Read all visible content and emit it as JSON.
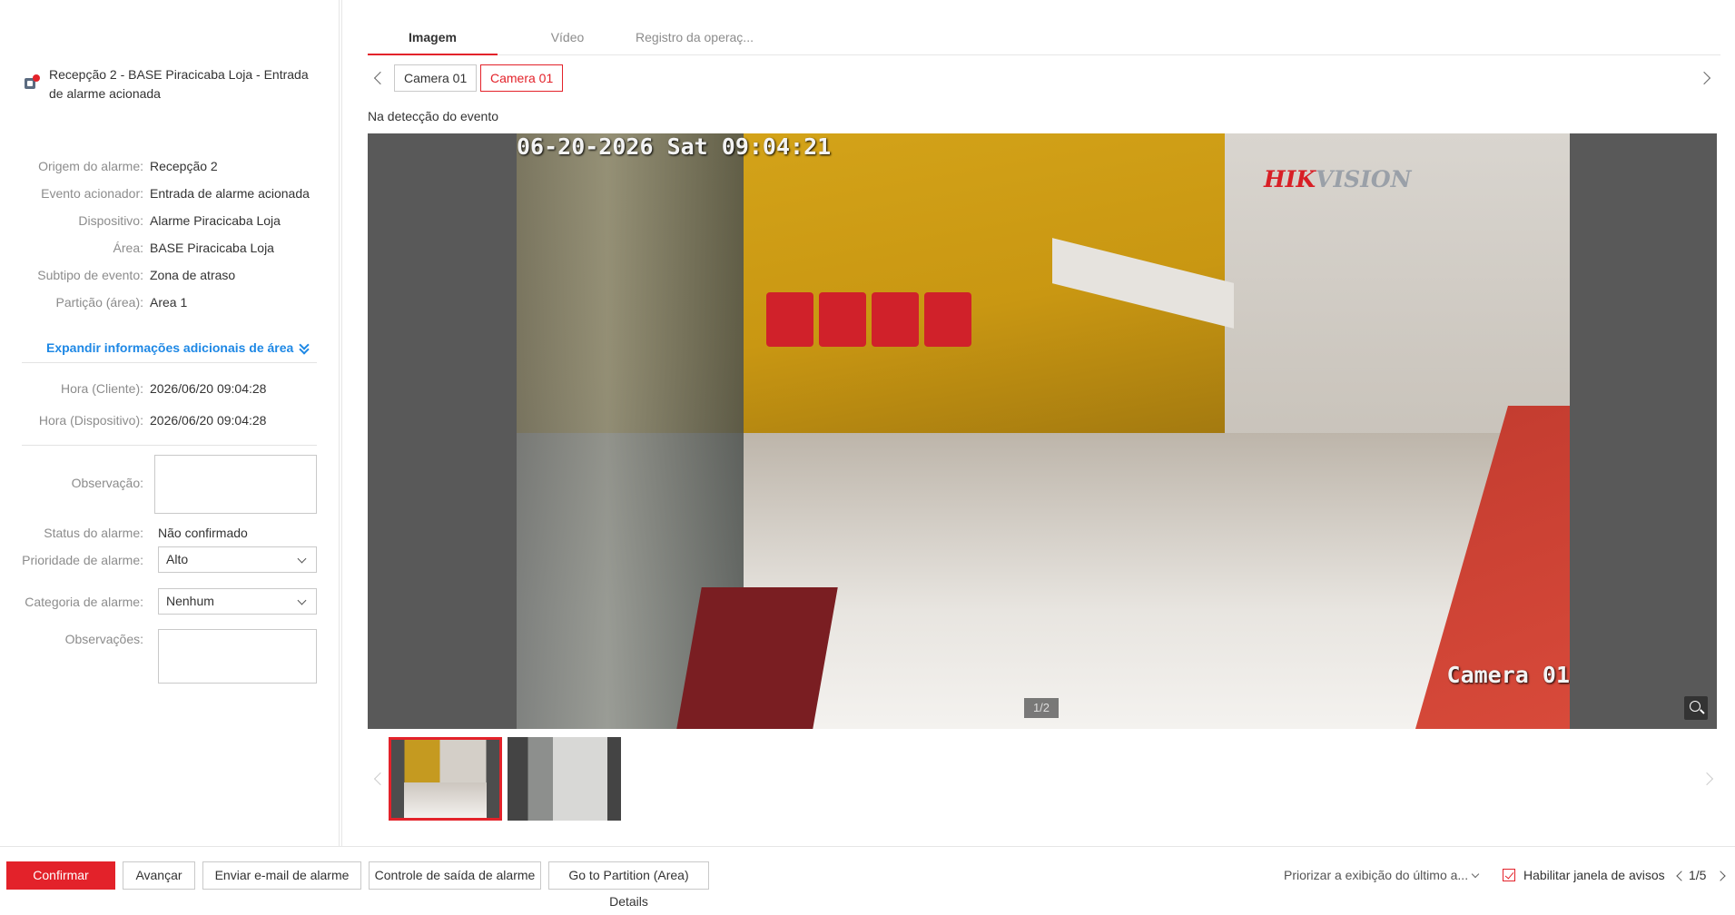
{
  "alarm": {
    "title": "Recepção 2 - BASE Piracicaba Loja - Entrada de alarme acionada"
  },
  "info": [
    {
      "key": "Origem do alarme:",
      "value": "Recepção 2"
    },
    {
      "key": "Evento acionador:",
      "value": "Entrada de alarme acionada"
    },
    {
      "key": "Dispositivo:",
      "value": "Alarme Piracicaba Loja"
    },
    {
      "key": "Área:",
      "value": "BASE Piracicaba Loja"
    },
    {
      "key": "Subtipo de evento:",
      "value": "Zona de atraso"
    },
    {
      "key": "Partição (área):",
      "value": "Area 1"
    }
  ],
  "expand_label": "Expandir informações adicionais de área",
  "times": [
    {
      "key": "Hora (Cliente):",
      "value": "2026/06/20 09:04:28"
    },
    {
      "key": "Hora (Dispositivo):",
      "value": "2026/06/20 09:04:28"
    }
  ],
  "form": {
    "observacao_label": "Observação:",
    "status_label": "Status do alarme:",
    "status_value": "Não confirmado",
    "prioridade_label": "Prioridade de alarme:",
    "prioridade_value": "Alto",
    "categoria_label": "Categoria de alarme:",
    "categoria_value": "Nenhum",
    "observacoes_label": "Observações:"
  },
  "tabs": [
    "Imagem",
    "Vídeo",
    "Registro da operaç..."
  ],
  "cameras": [
    "Camera 01",
    "Camera 01"
  ],
  "event_label": "Na detecção do evento",
  "viewer": {
    "osd_time": "06-20-2026 Sat 09:04:21",
    "osd_brand_a": "HIK",
    "osd_brand_b": "VISION",
    "osd_camera": "Camera 01",
    "page_indicator": "1/2"
  },
  "bottom": {
    "confirm": "Confirmar",
    "advance": "Avançar",
    "email": "Enviar e-mail de alarme",
    "output": "Controle de saída de alarme",
    "partition": "Go to Partition (Area) Details",
    "priority_text": "Priorizar a exibição do último a...",
    "enable_popup": "Habilitar janela de avisos",
    "page": "1/5"
  },
  "colors": {
    "accent": "#e3222a",
    "link": "#1e88e5"
  }
}
